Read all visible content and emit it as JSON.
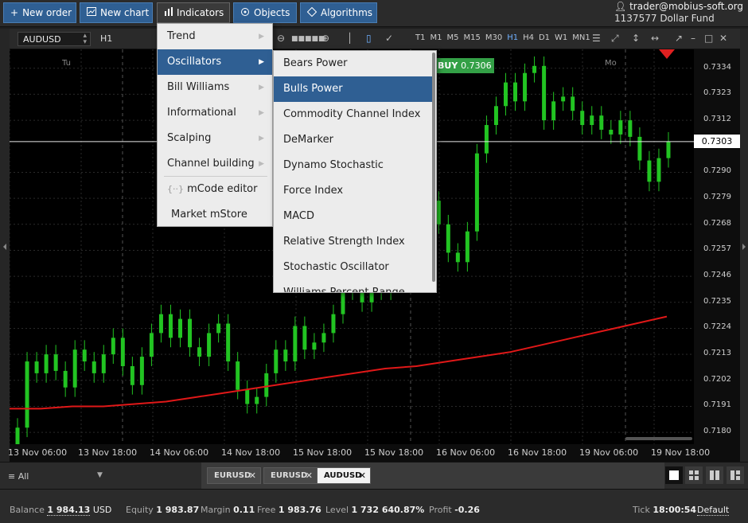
{
  "toolbar": {
    "buttons": [
      {
        "label": "New order",
        "icon": "plus-icon"
      },
      {
        "label": "New chart",
        "icon": "chart-icon"
      },
      {
        "label": "Indicators",
        "icon": "indicators-icon"
      },
      {
        "label": "Objects",
        "icon": "objects-icon"
      },
      {
        "label": "Algorithms",
        "icon": "algorithms-icon"
      }
    ],
    "account_email": "trader@mobius-soft.org",
    "account_id": "1137577",
    "account_name": "Dollar Fund"
  },
  "chart_toolbar": {
    "symbol": "AUDUSD",
    "timeframe": "H1",
    "timeframes": [
      "T1",
      "M1",
      "M5",
      "M15",
      "M30",
      "H1",
      "H4",
      "D1",
      "W1",
      "MN1"
    ],
    "selected_timeframe": "H1"
  },
  "chart": {
    "day_labels": [
      "Tu",
      "Mo"
    ],
    "buy_label": "BUY",
    "buy_price": "0.7306",
    "current_price": "0.7303",
    "price_ticks": [
      "0.7334",
      "0.7323",
      "0.7312",
      "0.7290",
      "0.7279",
      "0.7268",
      "0.7257",
      "0.7246",
      "0.7235",
      "0.7224",
      "0.7213",
      "0.7202",
      "0.7191",
      "0.7180"
    ],
    "time_ticks": [
      "13 Nov 06:00",
      "13 Nov 18:00",
      "14 Nov 06:00",
      "14 Nov 18:00",
      "15 Nov 18:00",
      "15 Nov 18:00",
      "16 Nov 06:00",
      "16 Nov 18:00",
      "19 Nov 06:00",
      "19 Nov 18:00"
    ],
    "colors": {
      "bull": "#22c422",
      "ma": "#e01818",
      "background": "#000000"
    }
  },
  "chart_data": {
    "type": "candlestick",
    "symbol": "AUDUSD",
    "timeframe": "H1",
    "ylim": [
      0.7175,
      0.7342
    ],
    "closes": [
      0.7182,
      0.721,
      0.7205,
      0.7213,
      0.7206,
      0.7199,
      0.7215,
      0.721,
      0.7205,
      0.7213,
      0.722,
      0.7208,
      0.72,
      0.7212,
      0.7222,
      0.723,
      0.722,
      0.7228,
      0.7216,
      0.7212,
      0.7222,
      0.7226,
      0.721,
      0.7198,
      0.7192,
      0.7195,
      0.7205,
      0.7215,
      0.721,
      0.7225,
      0.7215,
      0.7218,
      0.7222,
      0.723,
      0.724,
      0.7245,
      0.7235,
      0.724,
      0.724,
      0.729,
      0.7262,
      0.727,
      0.728,
      0.7278,
      0.7268,
      0.7256,
      0.7252,
      0.7265,
      0.7298,
      0.731,
      0.7318,
      0.7328,
      0.732,
      0.7332,
      0.7335,
      0.7312,
      0.732,
      0.7322,
      0.7316,
      0.731,
      0.7314,
      0.7308,
      0.7306,
      0.7312,
      0.7305,
      0.7295,
      0.7286,
      0.7296,
      0.7303
    ],
    "ma_series_name": "",
    "ma": [
      0.719,
      0.719,
      0.7191,
      0.7191,
      0.7192,
      0.7193,
      0.7195,
      0.7197,
      0.7199,
      0.7201,
      0.7203,
      0.7205,
      0.7207,
      0.7208,
      0.721,
      0.7212,
      0.7214,
      0.7217,
      0.722,
      0.7223,
      0.7226,
      0.7229
    ]
  },
  "indicators_menu": {
    "items": [
      {
        "label": "Trend",
        "submenu": true
      },
      {
        "label": "Oscillators",
        "submenu": true
      },
      {
        "label": "Bill Williams",
        "submenu": true
      },
      {
        "label": "Informational",
        "submenu": true
      },
      {
        "label": "Scalping",
        "submenu": true
      },
      {
        "label": "Channel building",
        "submenu": true
      },
      {
        "label": "mCode editor",
        "submenu": false
      },
      {
        "label": "Market mStore",
        "submenu": false
      }
    ],
    "selected": "Oscillators"
  },
  "oscillators_menu": {
    "items": [
      "Bears Power",
      "Bulls Power",
      "Commodity Channel Index",
      "DeMarker",
      "Dynamo Stochastic",
      "Force Index",
      "MACD",
      "Relative Strength Index",
      "Stochastic Oscillator",
      "Williams Percent Range"
    ],
    "selected": "Bulls Power"
  },
  "bottom": {
    "filter": "All",
    "tabs": [
      "EURUSD",
      "EURUSD",
      "AUDUSD"
    ],
    "selected_tab": "AUDUSD"
  },
  "status": {
    "balance_label": "Balance",
    "balance_value": "1 984.13",
    "balance_currency": "USD",
    "equity_label": "Equity",
    "equity_value": "1 983.87",
    "margin_label": "Margin",
    "margin_value": "0.11",
    "free_label": "Free",
    "free_value": "1 983.76",
    "level_label": "Level",
    "level_value": "1 732 640.87%",
    "profit_label": "Profit",
    "profit_value": "-0.26",
    "tick_label": "Tick",
    "tick_value": "18:00:54",
    "default_label": "Default"
  }
}
